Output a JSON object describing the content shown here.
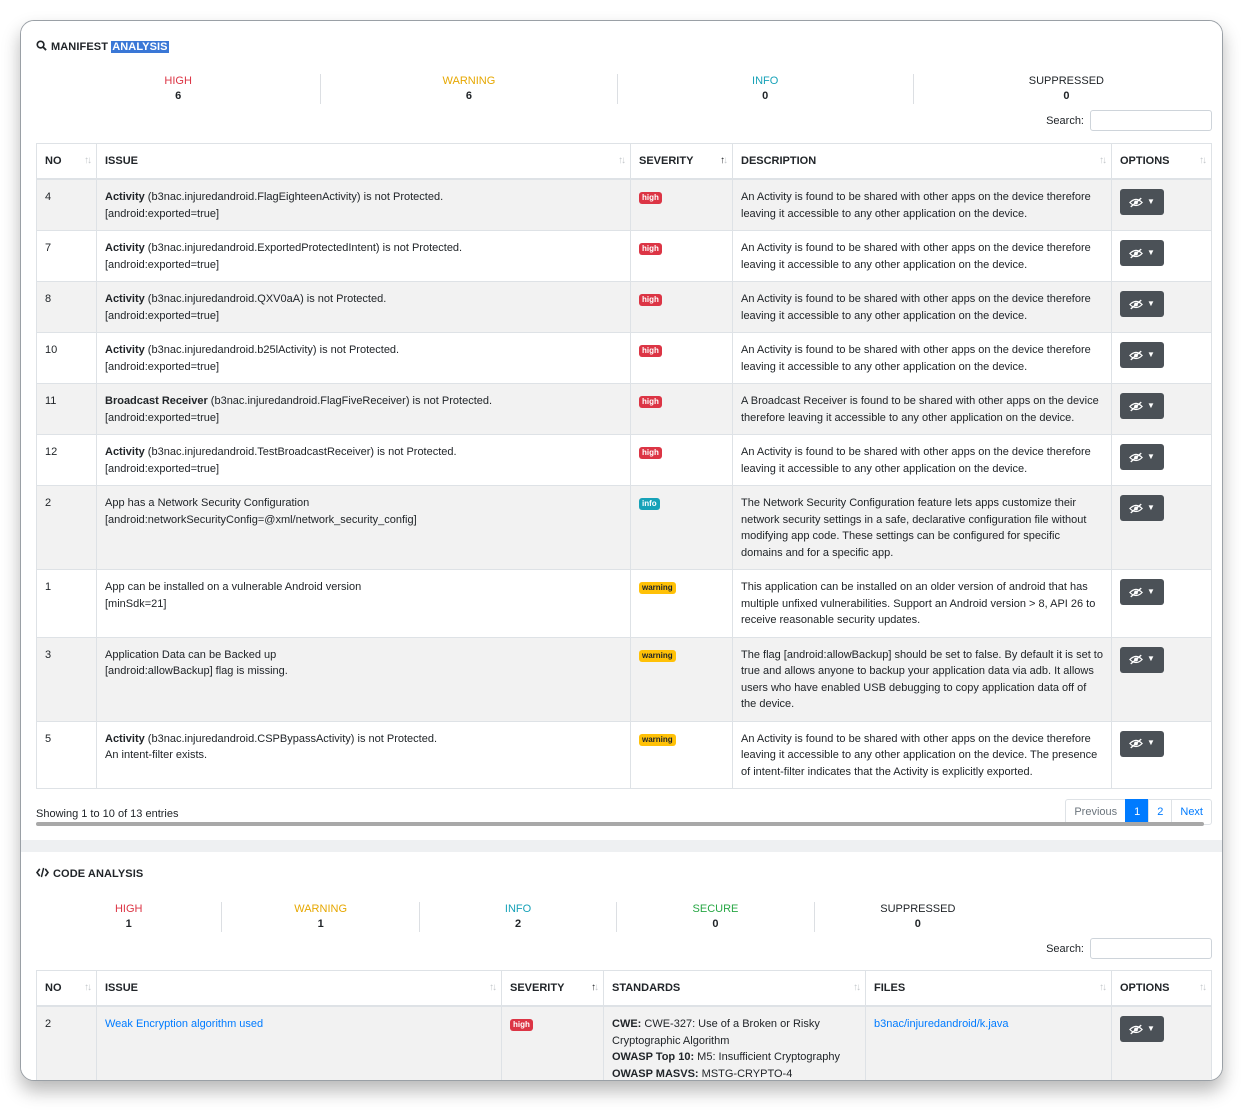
{
  "manifest": {
    "title_prefix": "MANIFEST",
    "title_selected": "ANALYSIS",
    "stats": [
      {
        "label": "HIGH",
        "value": "6"
      },
      {
        "label": "WARNING",
        "value": "6"
      },
      {
        "label": "INFO",
        "value": "0"
      },
      {
        "label": "SUPPRESSED",
        "value": "0"
      }
    ],
    "search_label": "Search:",
    "columns": [
      "NO",
      "ISSUE",
      "SEVERITY",
      "DESCRIPTION",
      "OPTIONS"
    ],
    "rows": [
      {
        "no": "4",
        "issue_bold": "Activity",
        "issue_rest": " (b3nac.injuredandroid.FlagEighteenActivity) is not Protected.",
        "issue_line2": "[android:exported=true]",
        "severity": "high",
        "description": "An Activity is found to be shared with other apps on the device therefore leaving it accessible to any other application on the device."
      },
      {
        "no": "7",
        "issue_bold": "Activity",
        "issue_rest": " (b3nac.injuredandroid.ExportedProtectedIntent) is not Protected.",
        "issue_line2": "[android:exported=true]",
        "severity": "high",
        "description": "An Activity is found to be shared with other apps on the device therefore leaving it accessible to any other application on the device."
      },
      {
        "no": "8",
        "issue_bold": "Activity",
        "issue_rest": " (b3nac.injuredandroid.QXV0aA) is not Protected.",
        "issue_line2": "[android:exported=true]",
        "severity": "high",
        "description": "An Activity is found to be shared with other apps on the device therefore leaving it accessible to any other application on the device."
      },
      {
        "no": "10",
        "issue_bold": "Activity",
        "issue_rest": " (b3nac.injuredandroid.b25lActivity) is not Protected.",
        "issue_line2": "[android:exported=true]",
        "severity": "high",
        "description": "An Activity is found to be shared with other apps on the device therefore leaving it accessible to any other application on the device."
      },
      {
        "no": "11",
        "issue_bold": "Broadcast Receiver",
        "issue_rest": " (b3nac.injuredandroid.FlagFiveReceiver) is not Protected.",
        "issue_line2": "[android:exported=true]",
        "severity": "high",
        "description": "A Broadcast Receiver is found to be shared with other apps on the device therefore leaving it accessible to any other application on the device."
      },
      {
        "no": "12",
        "issue_bold": "Activity",
        "issue_rest": " (b3nac.injuredandroid.TestBroadcastReceiver) is not Protected.",
        "issue_line2": "[android:exported=true]",
        "severity": "high",
        "description": "An Activity is found to be shared with other apps on the device therefore leaving it accessible to any other application on the device."
      },
      {
        "no": "2",
        "issue_bold": "",
        "issue_rest": "App has a Network Security Configuration",
        "issue_line2": "[android:networkSecurityConfig=@xml/network_security_config]",
        "severity": "info",
        "description": "The Network Security Configuration feature lets apps customize their network security settings in a safe, declarative configuration file without modifying app code. These settings can be configured for specific domains and for a specific app."
      },
      {
        "no": "1",
        "issue_bold": "",
        "issue_rest": "App can be installed on a vulnerable Android version",
        "issue_line2": "[minSdk=21]",
        "severity": "warning",
        "description": "This application can be installed on an older version of android that has multiple unfixed vulnerabilities. Support an Android version > 8, API 26 to receive reasonable security updates."
      },
      {
        "no": "3",
        "issue_bold": "",
        "issue_rest": "Application Data can be Backed up",
        "issue_line2": "[android:allowBackup] flag is missing.",
        "severity": "warning",
        "description": "The flag [android:allowBackup] should be set to false. By default it is set to true and allows anyone to backup your application data via adb. It allows users who have enabled USB debugging to copy application data off of the device."
      },
      {
        "no": "5",
        "issue_bold": "Activity",
        "issue_rest": " (b3nac.injuredandroid.CSPBypassActivity) is not Protected.",
        "issue_line2": "An intent-filter exists.",
        "severity": "warning",
        "description": "An Activity is found to be shared with other apps on the device therefore leaving it accessible to any other application on the device. The presence of intent-filter indicates that the Activity is explicitly exported."
      }
    ],
    "info": "Showing 1 to 10 of 13 entries",
    "pager": {
      "previous": "Previous",
      "pages": [
        "1",
        "2"
      ],
      "next": "Next"
    }
  },
  "code": {
    "title": "CODE ANALYSIS",
    "stats": [
      {
        "label": "HIGH",
        "value": "1"
      },
      {
        "label": "WARNING",
        "value": "1"
      },
      {
        "label": "INFO",
        "value": "2"
      },
      {
        "label": "SECURE",
        "value": "0"
      },
      {
        "label": "SUPPRESSED",
        "value": "0"
      }
    ],
    "search_label": "Search:",
    "columns": [
      "NO",
      "ISSUE",
      "SEVERITY",
      "STANDARDS",
      "FILES",
      "OPTIONS"
    ],
    "rows": [
      {
        "no": "2",
        "issue": "Weak Encryption algorithm used",
        "severity": "high",
        "standards": [
          {
            "key": "CWE:",
            "val": " CWE-327: Use of a Broken or Risky Cryptographic Algorithm"
          },
          {
            "key": "OWASP Top 10:",
            "val": " M5: Insufficient Cryptography"
          },
          {
            "key": "OWASP MASVS:",
            "val": " MSTG-CRYPTO-4"
          }
        ],
        "file": "b3nac/injuredandroid/k.java"
      }
    ]
  },
  "colors": {
    "high": "#dc3545",
    "warning": "#ffc107",
    "info": "#17a2b8",
    "secure": "#28a745",
    "primary": "#007bff"
  }
}
